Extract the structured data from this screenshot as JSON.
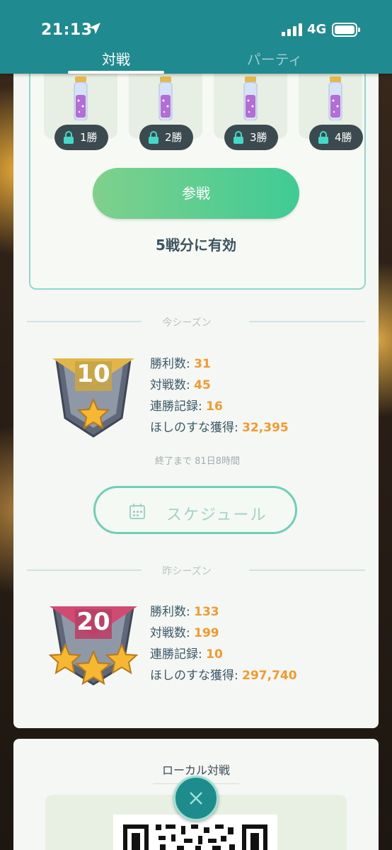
{
  "status_bar": {
    "time": "21:13",
    "network": "4G",
    "icons": [
      "location-arrow-icon",
      "cellular-signal-icon",
      "battery-icon"
    ]
  },
  "tabs": [
    {
      "label": "対戦",
      "active": true
    },
    {
      "label": "パーティ",
      "active": false
    }
  ],
  "rewards": [
    {
      "label": "1勝",
      "icon": "lock-icon"
    },
    {
      "label": "2勝",
      "icon": "lock-icon"
    },
    {
      "label": "3勝",
      "icon": "lock-icon"
    },
    {
      "label": "4勝",
      "icon": "lock-icon"
    }
  ],
  "join_button": "参戦",
  "valid_text": "5戦分に有効",
  "current_season": {
    "header": "今シーズン",
    "rank": "10",
    "stars": 1,
    "stats": [
      {
        "label": "勝利数: ",
        "value": "31"
      },
      {
        "label": "対戦数: ",
        "value": "45"
      },
      {
        "label": "連勝記録: ",
        "value": "16"
      },
      {
        "label": "ほしのすな獲得: ",
        "value": "32,395"
      }
    ],
    "ends_in": "終了まで 81日8時間"
  },
  "schedule_button": "スケジュール",
  "previous_season": {
    "header": "昨シーズン",
    "rank": "20",
    "stars": 3,
    "stats": [
      {
        "label": "勝利数: ",
        "value": "133"
      },
      {
        "label": "対戦数: ",
        "value": "199"
      },
      {
        "label": "連勝記録: ",
        "value": "10"
      },
      {
        "label": "ほしのすな獲得: ",
        "value": "297,740"
      }
    ]
  },
  "local_battle": {
    "title": "ローカル対戦"
  },
  "colors": {
    "topbar": "#1f8b91",
    "accent_orange": "#f19a2f",
    "join_green": "#3fcb95"
  }
}
